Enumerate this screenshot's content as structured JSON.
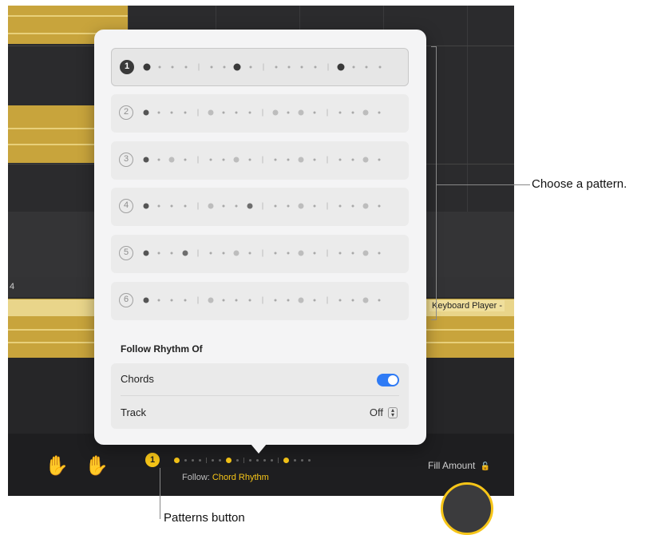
{
  "popover": {
    "patterns": [
      {
        "number": "1",
        "selected": true,
        "dots": [
          3,
          1,
          1,
          1,
          "|",
          1,
          1,
          3,
          1,
          "|",
          1,
          1,
          1,
          1,
          "|",
          3,
          1,
          1,
          1
        ]
      },
      {
        "number": "2",
        "selected": false,
        "dots": [
          2,
          1,
          1,
          1,
          "|",
          2,
          1,
          1,
          1,
          "|",
          2,
          1,
          2,
          1,
          "|",
          1,
          1,
          2,
          1
        ]
      },
      {
        "number": "3",
        "selected": false,
        "dots": [
          2,
          1,
          2,
          1,
          "|",
          1,
          1,
          2,
          1,
          "|",
          1,
          1,
          2,
          1,
          "|",
          1,
          1,
          2,
          1
        ]
      },
      {
        "number": "4",
        "selected": false,
        "dots": [
          2,
          1,
          1,
          1,
          "|",
          2,
          1,
          1,
          2,
          "|",
          1,
          1,
          2,
          1,
          "|",
          1,
          1,
          2,
          1
        ]
      },
      {
        "number": "5",
        "selected": false,
        "dots": [
          2,
          1,
          1,
          2,
          "|",
          1,
          1,
          2,
          1,
          "|",
          1,
          1,
          2,
          1,
          "|",
          1,
          1,
          2,
          1
        ]
      },
      {
        "number": "6",
        "selected": false,
        "dots": [
          2,
          1,
          1,
          1,
          "|",
          2,
          1,
          1,
          1,
          "|",
          1,
          1,
          2,
          1,
          "|",
          1,
          1,
          2,
          1
        ]
      }
    ],
    "follow_title": "Follow Rhythm Of",
    "chords_label": "Chords",
    "chords_on": true,
    "track_label": "Track",
    "track_value": "Off"
  },
  "editor": {
    "ruler_number": "4",
    "region_label": "Keyboard Player -",
    "patterns_button_number": "1",
    "follow_prefix": "Follow: ",
    "follow_value": "Chord Rhythm",
    "fill_amount_label": "Fill Amount"
  },
  "callouts": {
    "choose_pattern": "Choose a pattern.",
    "patterns_button": "Patterns button"
  },
  "colors": {
    "accent_yellow": "#f6c518",
    "toggle_blue": "#2f7bf5",
    "region_gold": "#c8a43c"
  },
  "icons": {
    "hand_left": "raised-hand-icon",
    "hand_right": "raised-hand-icon",
    "lock": "lock-icon",
    "stepper": "updown-chevron-icon"
  }
}
